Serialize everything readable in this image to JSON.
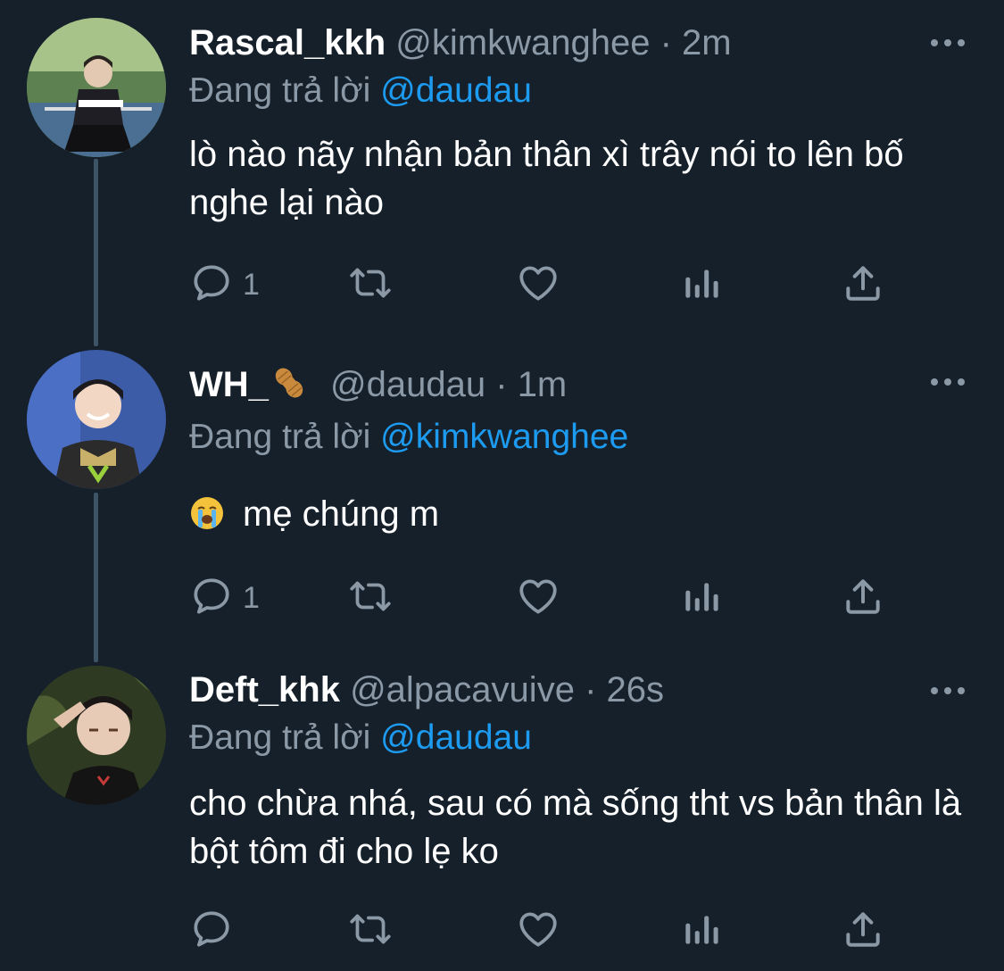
{
  "colors": {
    "background": "#15202b",
    "text_primary": "#ffffff",
    "text_secondary": "#8b98a5",
    "link": "#1d9bf0",
    "thread_line": "#3d5466"
  },
  "tweets": [
    {
      "display_name": "Rascal_kkh",
      "handle": "@kimkwanghee",
      "separator": "·",
      "time": "2m",
      "replying_prefix": "Đang trả lời",
      "replying_to": "@daudau",
      "text": "lò nào nãy nhận bản thân xì trây nói to lên bố nghe lại nào",
      "reply_count": "1",
      "avatar_icon": "user-photo-avatar",
      "icons": [
        "reply-icon",
        "retweet-icon",
        "like-icon",
        "analytics-icon",
        "share-icon",
        "more-icon"
      ]
    },
    {
      "display_name": "WH_",
      "display_name_badge": "peanut-emoji",
      "handle": "@daudau",
      "separator": "·",
      "time": "1m",
      "replying_prefix": "Đang trả lời",
      "replying_to": "@kimkwanghee",
      "text_emoji": "loudly-crying-face-emoji",
      "text": "mẹ chúng m",
      "reply_count": "1",
      "avatar_icon": "user-photo-avatar",
      "icons": [
        "reply-icon",
        "retweet-icon",
        "like-icon",
        "analytics-icon",
        "share-icon",
        "more-icon"
      ]
    },
    {
      "display_name": "Deft_khk",
      "handle": "@alpacavuive",
      "separator": "·",
      "time": "26s",
      "replying_prefix": "Đang trả lời",
      "replying_to": "@daudau",
      "text": "cho chừa nhá, sau có mà sống tht vs bản thân là bột tôm đi cho lẹ ko",
      "reply_count": "",
      "avatar_icon": "user-photo-avatar",
      "icons": [
        "reply-icon",
        "retweet-icon",
        "like-icon",
        "analytics-icon",
        "share-icon",
        "more-icon"
      ]
    }
  ]
}
